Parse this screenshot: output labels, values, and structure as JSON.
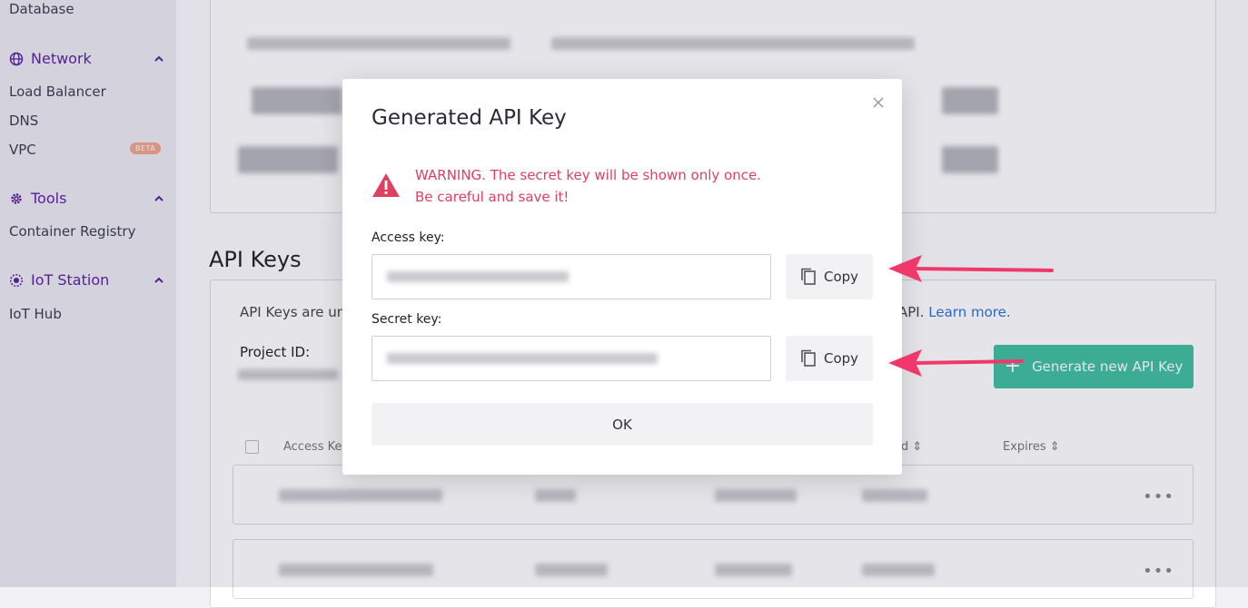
{
  "sidebar": {
    "database_label": "Database",
    "network": {
      "label": "Network",
      "icon": "globe-icon",
      "items": [
        "Load Balancer",
        "DNS",
        "VPC"
      ],
      "vpc_badge": "BETA"
    },
    "tools": {
      "label": "Tools",
      "icon": "gear-icon",
      "items": [
        "Container Registry"
      ]
    },
    "iot": {
      "label": "IoT Station",
      "icon": "iot-icon",
      "items": [
        "IoT Hub"
      ]
    }
  },
  "main": {
    "api_keys_title": "API Keys",
    "description": "API Keys are uni",
    "description_end": "API.",
    "learn_more": "Learn more.",
    "project_id_label": "Project ID:",
    "generate_button": "Generate new API Key",
    "table": {
      "headers": [
        "Access Key",
        "d",
        "Expires"
      ]
    }
  },
  "modal": {
    "title": "Generated API Key",
    "warning_line1": "WARNING. The secret key will be shown only once.",
    "warning_line2": "Be careful and save it!",
    "access_key_label": "Access key:",
    "secret_key_label": "Secret key:",
    "copy_label": "Copy",
    "ok_label": "OK"
  },
  "colors": {
    "accent_purple": "#5a1e9e",
    "warning_red": "#e0405f",
    "generate_green": "#3fbfa0",
    "arrow_pink": "#f0386b",
    "beta_badge": "#f0a58a"
  }
}
